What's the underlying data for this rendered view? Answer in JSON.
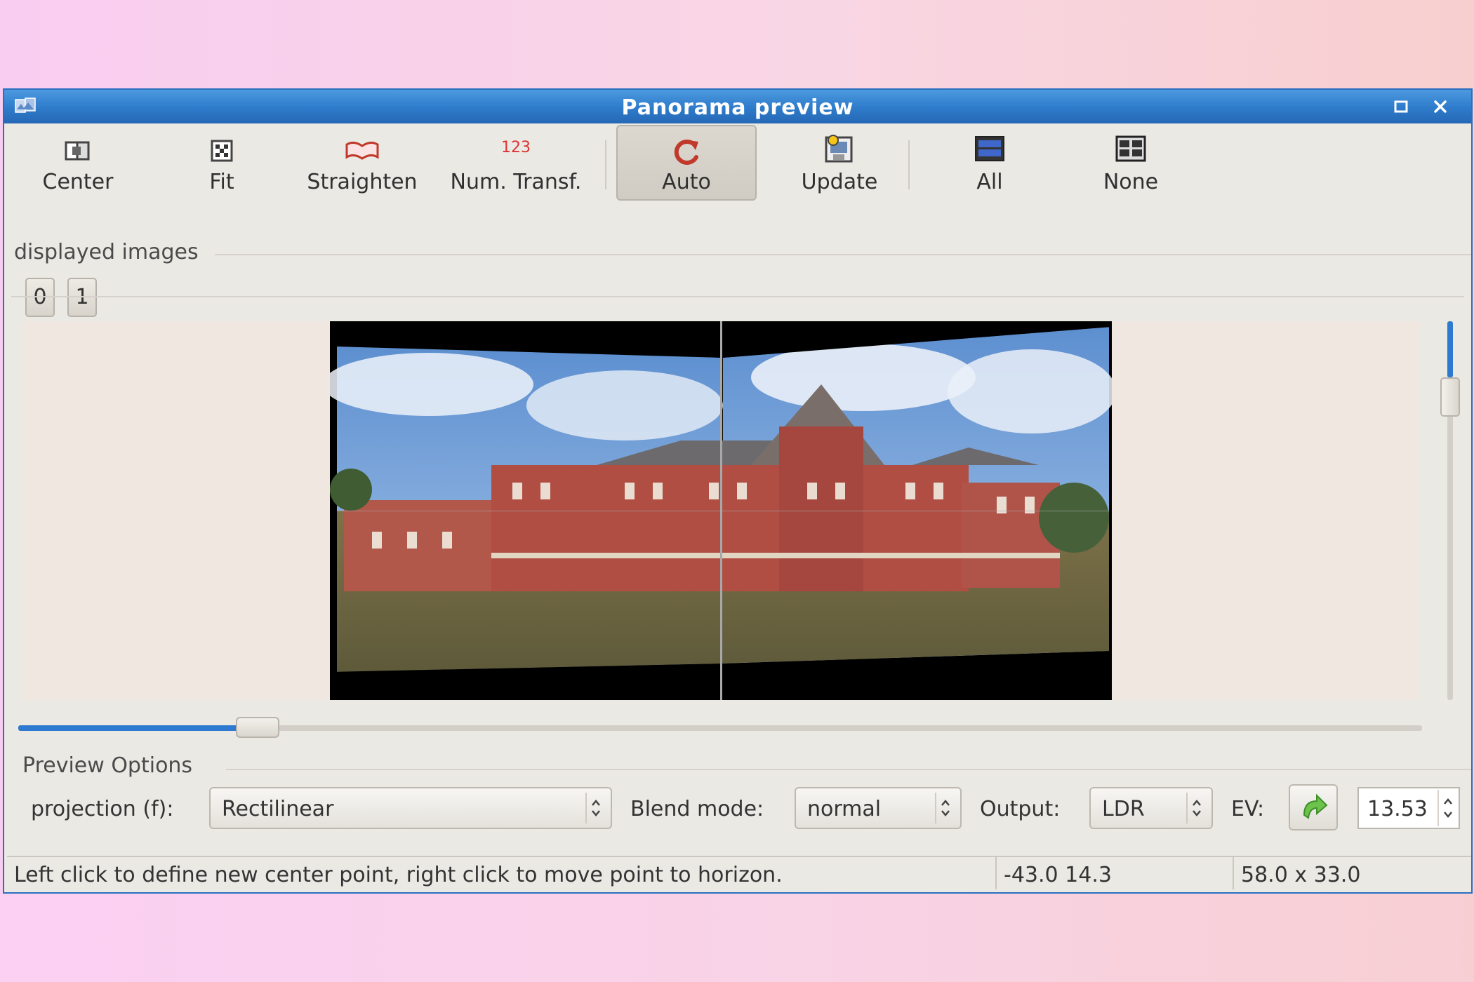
{
  "window": {
    "title": "Panorama preview",
    "maximize_glyph": "🗖",
    "close_glyph": "✕"
  },
  "toolbar": {
    "center": {
      "label": "Center",
      "icon": "center-icon"
    },
    "fit": {
      "label": "Fit",
      "icon": "fit-icon"
    },
    "straighten": {
      "label": "Straighten",
      "icon": "straighten-icon"
    },
    "num_transf": {
      "label": "Num. Transf.",
      "icon_text": "123"
    },
    "auto": {
      "label": "Auto",
      "icon": "refresh-icon",
      "pressed": true
    },
    "update": {
      "label": "Update",
      "icon": "update-icon"
    },
    "all": {
      "label": "All",
      "icon": "all-images-icon"
    },
    "none": {
      "label": "None",
      "icon": "no-images-icon"
    }
  },
  "displayed_images": {
    "label": "displayed images",
    "buttons": [
      "0",
      "1"
    ]
  },
  "preview": {
    "vertical_slider_fraction": 0.15,
    "horizontal_slider_fraction": 0.17
  },
  "options": {
    "title": "Preview Options",
    "projection_label": "projection (f):",
    "projection_value": "Rectilinear",
    "blend_label": "Blend mode:",
    "blend_value": "normal",
    "output_label": "Output:",
    "output_value": "LDR",
    "ev_label": "EV:",
    "ev_value": "13.53"
  },
  "status": {
    "message": "Left click to define new center point, right click to move point to horizon.",
    "coords": "-43.0 14.3",
    "fov": "58.0 x 33.0"
  },
  "colors": {
    "titlebar": "#2f7dcc",
    "accent": "#2d7ad0",
    "window_bg": "#ebe9e4"
  }
}
